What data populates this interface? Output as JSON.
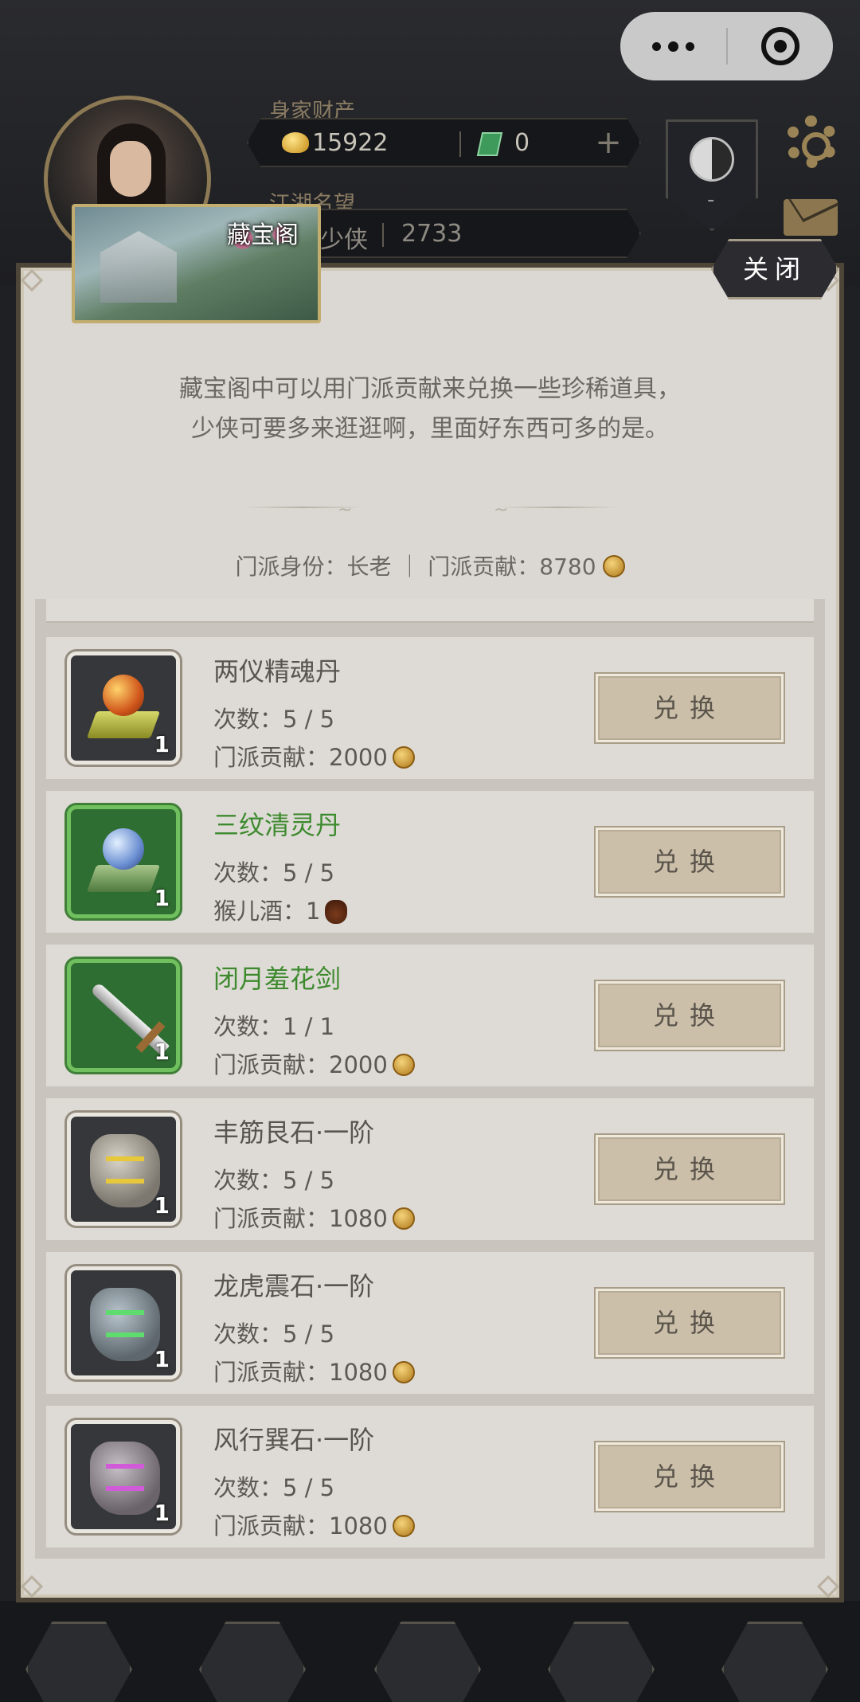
{
  "capsule": {
    "more_icon": "more-dots-icon",
    "close_icon": "target-circle-icon"
  },
  "header": {
    "wealth_label": "身家财产",
    "gold_value": "15922",
    "jade_value": "0",
    "plus_label": "+",
    "fame_label": "江湖名望",
    "fame_rank": "少侠",
    "fame_value": "2733",
    "sect_badge_text": "-"
  },
  "dialog": {
    "title": "藏宝阁",
    "close_label": "关闭",
    "intro_line1": "藏宝阁中可以用门派贡献来兑换一些珍稀道具，",
    "intro_line2": "少侠可要多来逛逛啊，里面好东西可多的是。",
    "status_text": "门派身份：长老 ｜ 门派贡献：8780"
  },
  "items": [
    {
      "name": "两仪精魂丹",
      "quality": "white",
      "qty": "1",
      "count": "次数：5 / 5",
      "cost": "门派贡献：2000",
      "cost_icon": "contribution-coin-icon",
      "button": "兑换"
    },
    {
      "name": "三纹清灵丹",
      "quality": "green",
      "qty": "1",
      "count": "次数：5 / 5",
      "cost": "猴儿酒：1",
      "cost_icon": "wine-jar-icon",
      "button": "兑换"
    },
    {
      "name": "闭月羞花剑",
      "quality": "green",
      "qty": "1",
      "count": "次数：1 / 1",
      "cost": "门派贡献：2000",
      "cost_icon": "contribution-coin-icon",
      "button": "兑换"
    },
    {
      "name": "丰筋艮石·一阶",
      "quality": "white",
      "qty": "1",
      "count": "次数：5 / 5",
      "cost": "门派贡献：1080",
      "cost_icon": "contribution-coin-icon",
      "button": "兑换"
    },
    {
      "name": "龙虎震石·一阶",
      "quality": "white",
      "qty": "1",
      "count": "次数：5 / 5",
      "cost": "门派贡献：1080",
      "cost_icon": "contribution-coin-icon",
      "button": "兑换"
    },
    {
      "name": "风行巽石·一阶",
      "quality": "white",
      "qty": "1",
      "count": "次数：5 / 5",
      "cost": "门派贡献：1080",
      "cost_icon": "contribution-coin-icon",
      "button": "兑换"
    }
  ]
}
